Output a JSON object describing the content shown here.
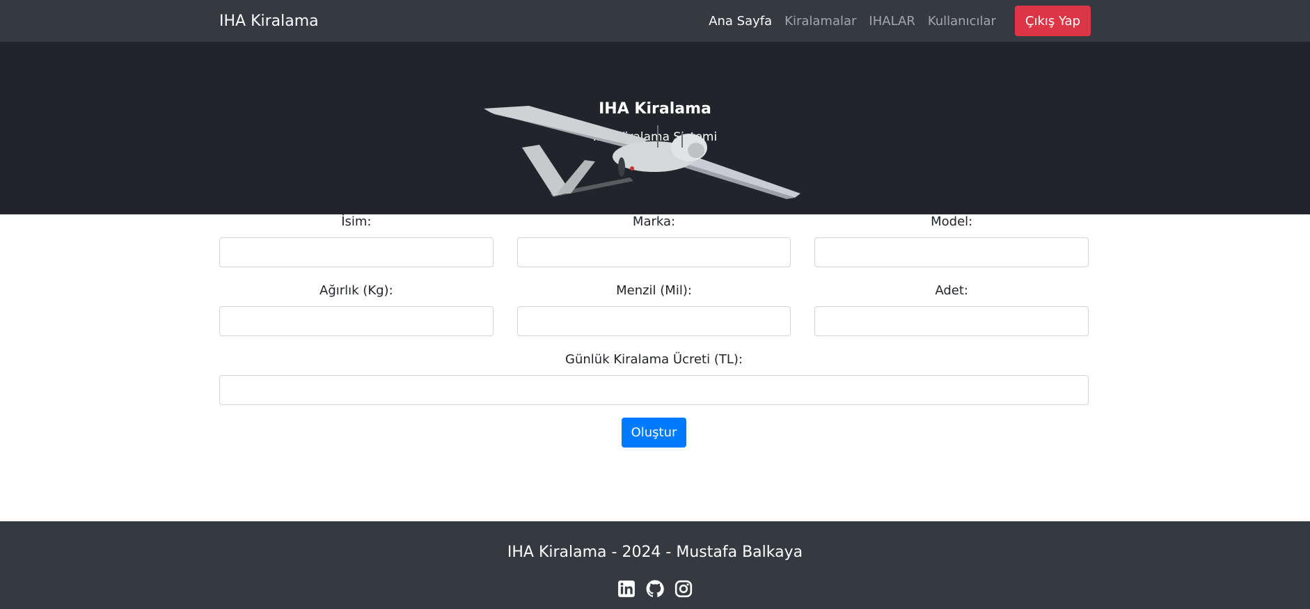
{
  "navbar": {
    "brand": "IHA Kiralama",
    "links": [
      {
        "label": "Ana Sayfa",
        "active": true
      },
      {
        "label": "Kiralamalar",
        "active": false
      },
      {
        "label": "IHALAR",
        "active": false
      },
      {
        "label": "Kullanıcılar",
        "active": false
      }
    ],
    "logout_label": "Çıkış Yap"
  },
  "hero": {
    "title": "IHA Kiralama",
    "subtitle": "IHA Kiralama Sistemi"
  },
  "form": {
    "fields": {
      "isim": {
        "label": "İsim:",
        "value": ""
      },
      "marka": {
        "label": "Marka:",
        "value": ""
      },
      "model": {
        "label": "Model:",
        "value": ""
      },
      "agirlik": {
        "label": "Ağırlık (Kg):",
        "value": ""
      },
      "menzil": {
        "label": "Menzil (Mil):",
        "value": ""
      },
      "adet": {
        "label": "Adet:",
        "value": ""
      },
      "ucret": {
        "label": "Günlük Kiralama Ücreti (TL):",
        "value": ""
      }
    },
    "submit_label": "Oluştur"
  },
  "footer": {
    "text": "IHA Kiralama - 2024 - Mustafa Balkaya",
    "icons": [
      "linkedin-icon",
      "github-icon",
      "instagram-icon"
    ]
  },
  "colors": {
    "navbar_bg": "#343a40",
    "hero_bg": "#212529",
    "danger": "#dc3545",
    "primary": "#007bff"
  }
}
